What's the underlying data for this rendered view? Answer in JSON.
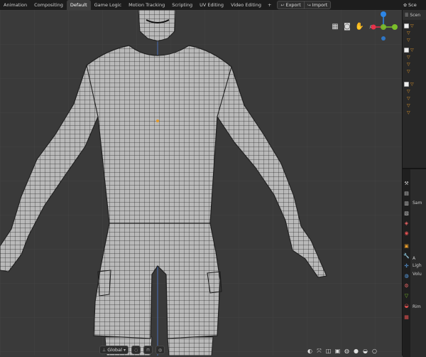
{
  "workspace_tabs": [
    "Animation",
    "Compositing",
    "Default",
    "Game Logic",
    "Motion Tracking",
    "Scripting",
    "UV Editing",
    "Video Editing"
  ],
  "active_tab": "Default",
  "add_tab_label": "+",
  "export_label": "Export",
  "import_label": "Import",
  "scene_selector": "Sce",
  "outliner_header": "Scen",
  "properties": {
    "section_label": "Sam",
    "labels": [
      "A",
      "Ligh",
      "Volu",
      "Rim"
    ]
  },
  "bottom_bar": {
    "orientation": "Global"
  },
  "navigation_gizmo": {
    "x_color": "#e8324a",
    "y_color": "#7bbf2a",
    "z_color": "#2d86e6"
  },
  "colors": {
    "viewport_bg": "#3a3a3a",
    "mesh_fill": "#b6b6b6",
    "wire": "#262626"
  }
}
